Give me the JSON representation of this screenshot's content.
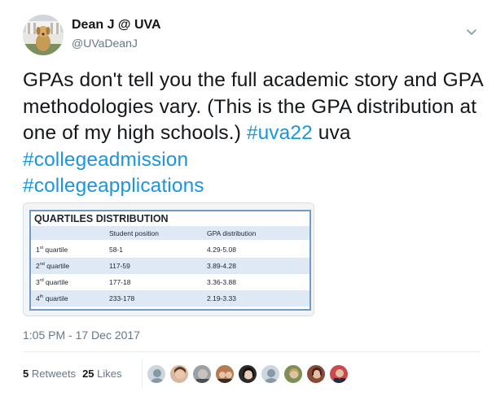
{
  "author": {
    "name": "Dean J @ UVA",
    "handle": "@UVaDeanJ"
  },
  "tweet": {
    "text_plain_1": "GPAs don't tell you the full academic story and GPA methodologies vary. (This is the GPA distribution at one of my high schools.) ",
    "hashtag_1": "#uva22",
    "text_plain_2": " uva ",
    "hashtag_2": "#collegeadmission",
    "hashtag_3": "#collegeapplications",
    "timestamp": "1:05 PM - 17 Dec 2017"
  },
  "media_table": {
    "title": "QUARTILES DISTRIBUTION",
    "headers": [
      "Student position",
      "GPA distribution"
    ],
    "rows": [
      {
        "num": "1",
        "suffix": "st",
        "word": "quartile",
        "position": "58-1",
        "gpa": "4.29-5.08"
      },
      {
        "num": "2",
        "suffix": "nd",
        "word": "quartile",
        "position": "117-59",
        "gpa": "3.89-4.28"
      },
      {
        "num": "3",
        "suffix": "rd",
        "word": "quartile",
        "position": "177-18",
        "gpa": "3.36-3.88"
      },
      {
        "num": "4",
        "suffix": "th",
        "word": "quartile",
        "position": "233-178",
        "gpa": "2.19-3.33"
      }
    ]
  },
  "stats": {
    "retweets_count": "5",
    "retweets_label": "Retweets",
    "likes_count": "25",
    "likes_label": "Likes"
  },
  "colors": {
    "hashtag": "#1b95e0",
    "secondary_text": "#657786",
    "table_border": "#6f9bc5",
    "table_band": "#dfe9f5"
  },
  "icons": {
    "menu": "chevron-down-icon",
    "avatar": "dog-avatar",
    "likers": [
      "default-egg-avatar",
      "user-avatar",
      "user-avatar",
      "user-avatar",
      "user-avatar",
      "default-egg-avatar",
      "user-avatar",
      "user-avatar",
      "user-avatar"
    ]
  }
}
